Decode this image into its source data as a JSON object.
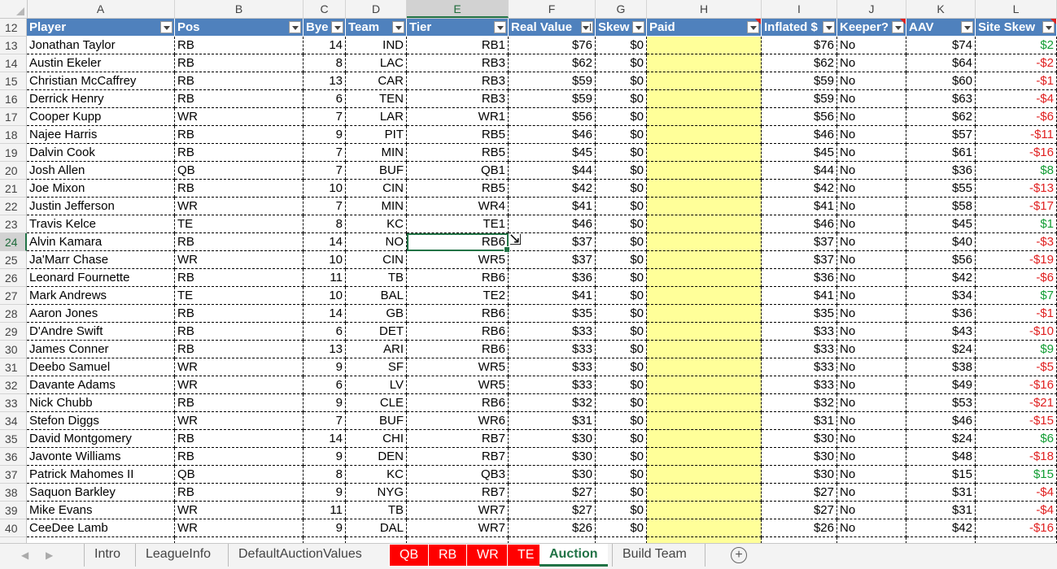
{
  "columns": [
    "A",
    "B",
    "C",
    "D",
    "E",
    "F",
    "G",
    "H",
    "I",
    "J",
    "K",
    "L"
  ],
  "selected_column": "E",
  "header_row_number": "12",
  "headers": [
    "Player",
    "Pos",
    "Bye",
    "Team",
    "Tier",
    "Real Value",
    "Skew",
    "Paid",
    "Inflated $",
    "Keeper?",
    "AAV",
    "Site Skew"
  ],
  "selected_row_number": "24",
  "rows": [
    {
      "n": "13",
      "player": "Jonathan Taylor",
      "pos": "RB",
      "bye": "14",
      "team": "IND",
      "tier": "RB1",
      "real": "$76",
      "skew": "$0",
      "paid": "",
      "inflated": "$76",
      "keeper": "No",
      "aav": "$74",
      "site": "$2",
      "sign": "pos"
    },
    {
      "n": "14",
      "player": "Austin Ekeler",
      "pos": "RB",
      "bye": "8",
      "team": "LAC",
      "tier": "RB3",
      "real": "$62",
      "skew": "$0",
      "paid": "",
      "inflated": "$62",
      "keeper": "No",
      "aav": "$64",
      "site": "-$2",
      "sign": "neg"
    },
    {
      "n": "15",
      "player": "Christian McCaffrey",
      "pos": "RB",
      "bye": "13",
      "team": "CAR",
      "tier": "RB3",
      "real": "$59",
      "skew": "$0",
      "paid": "",
      "inflated": "$59",
      "keeper": "No",
      "aav": "$60",
      "site": "-$1",
      "sign": "neg"
    },
    {
      "n": "16",
      "player": "Derrick Henry",
      "pos": "RB",
      "bye": "6",
      "team": "TEN",
      "tier": "RB3",
      "real": "$59",
      "skew": "$0",
      "paid": "",
      "inflated": "$59",
      "keeper": "No",
      "aav": "$63",
      "site": "-$4",
      "sign": "neg"
    },
    {
      "n": "17",
      "player": "Cooper Kupp",
      "pos": "WR",
      "bye": "7",
      "team": "LAR",
      "tier": "WR1",
      "real": "$56",
      "skew": "$0",
      "paid": "",
      "inflated": "$56",
      "keeper": "No",
      "aav": "$62",
      "site": "-$6",
      "sign": "neg"
    },
    {
      "n": "18",
      "player": "Najee Harris",
      "pos": "RB",
      "bye": "9",
      "team": "PIT",
      "tier": "RB5",
      "real": "$46",
      "skew": "$0",
      "paid": "",
      "inflated": "$46",
      "keeper": "No",
      "aav": "$57",
      "site": "-$11",
      "sign": "neg"
    },
    {
      "n": "19",
      "player": "Dalvin Cook",
      "pos": "RB",
      "bye": "7",
      "team": "MIN",
      "tier": "RB5",
      "real": "$45",
      "skew": "$0",
      "paid": "",
      "inflated": "$45",
      "keeper": "No",
      "aav": "$61",
      "site": "-$16",
      "sign": "neg"
    },
    {
      "n": "20",
      "player": "Josh Allen",
      "pos": "QB",
      "bye": "7",
      "team": "BUF",
      "tier": "QB1",
      "real": "$44",
      "skew": "$0",
      "paid": "",
      "inflated": "$44",
      "keeper": "No",
      "aav": "$36",
      "site": "$8",
      "sign": "pos"
    },
    {
      "n": "21",
      "player": "Joe Mixon",
      "pos": "RB",
      "bye": "10",
      "team": "CIN",
      "tier": "RB5",
      "real": "$42",
      "skew": "$0",
      "paid": "",
      "inflated": "$42",
      "keeper": "No",
      "aav": "$55",
      "site": "-$13",
      "sign": "neg"
    },
    {
      "n": "22",
      "player": "Justin Jefferson",
      "pos": "WR",
      "bye": "7",
      "team": "MIN",
      "tier": "WR4",
      "real": "$41",
      "skew": "$0",
      "paid": "",
      "inflated": "$41",
      "keeper": "No",
      "aav": "$58",
      "site": "-$17",
      "sign": "neg"
    },
    {
      "n": "23",
      "player": "Travis Kelce",
      "pos": "TE",
      "bye": "8",
      "team": "KC",
      "tier": "TE1",
      "real": "$46",
      "skew": "$0",
      "paid": "",
      "inflated": "$46",
      "keeper": "No",
      "aav": "$45",
      "site": "$1",
      "sign": "pos"
    },
    {
      "n": "24",
      "player": "Alvin Kamara",
      "pos": "RB",
      "bye": "14",
      "team": "NO",
      "tier": "RB6",
      "real": "$37",
      "skew": "$0",
      "paid": "",
      "inflated": "$37",
      "keeper": "No",
      "aav": "$40",
      "site": "-$3",
      "sign": "neg"
    },
    {
      "n": "25",
      "player": "Ja'Marr Chase",
      "pos": "WR",
      "bye": "10",
      "team": "CIN",
      "tier": "WR5",
      "real": "$37",
      "skew": "$0",
      "paid": "",
      "inflated": "$37",
      "keeper": "No",
      "aav": "$56",
      "site": "-$19",
      "sign": "neg"
    },
    {
      "n": "26",
      "player": "Leonard Fournette",
      "pos": "RB",
      "bye": "11",
      "team": "TB",
      "tier": "RB6",
      "real": "$36",
      "skew": "$0",
      "paid": "",
      "inflated": "$36",
      "keeper": "No",
      "aav": "$42",
      "site": "-$6",
      "sign": "neg"
    },
    {
      "n": "27",
      "player": "Mark Andrews",
      "pos": "TE",
      "bye": "10",
      "team": "BAL",
      "tier": "TE2",
      "real": "$41",
      "skew": "$0",
      "paid": "",
      "inflated": "$41",
      "keeper": "No",
      "aav": "$34",
      "site": "$7",
      "sign": "pos"
    },
    {
      "n": "28",
      "player": "Aaron Jones",
      "pos": "RB",
      "bye": "14",
      "team": "GB",
      "tier": "RB6",
      "real": "$35",
      "skew": "$0",
      "paid": "",
      "inflated": "$35",
      "keeper": "No",
      "aav": "$36",
      "site": "-$1",
      "sign": "neg"
    },
    {
      "n": "29",
      "player": "D'Andre Swift",
      "pos": "RB",
      "bye": "6",
      "team": "DET",
      "tier": "RB6",
      "real": "$33",
      "skew": "$0",
      "paid": "",
      "inflated": "$33",
      "keeper": "No",
      "aav": "$43",
      "site": "-$10",
      "sign": "neg"
    },
    {
      "n": "30",
      "player": "James Conner",
      "pos": "RB",
      "bye": "13",
      "team": "ARI",
      "tier": "RB6",
      "real": "$33",
      "skew": "$0",
      "paid": "",
      "inflated": "$33",
      "keeper": "No",
      "aav": "$24",
      "site": "$9",
      "sign": "pos"
    },
    {
      "n": "31",
      "player": "Deebo Samuel",
      "pos": "WR",
      "bye": "9",
      "team": "SF",
      "tier": "WR5",
      "real": "$33",
      "skew": "$0",
      "paid": "",
      "inflated": "$33",
      "keeper": "No",
      "aav": "$38",
      "site": "-$5",
      "sign": "neg"
    },
    {
      "n": "32",
      "player": "Davante Adams",
      "pos": "WR",
      "bye": "6",
      "team": "LV",
      "tier": "WR5",
      "real": "$33",
      "skew": "$0",
      "paid": "",
      "inflated": "$33",
      "keeper": "No",
      "aav": "$49",
      "site": "-$16",
      "sign": "neg"
    },
    {
      "n": "33",
      "player": "Nick Chubb",
      "pos": "RB",
      "bye": "9",
      "team": "CLE",
      "tier": "RB6",
      "real": "$32",
      "skew": "$0",
      "paid": "",
      "inflated": "$32",
      "keeper": "No",
      "aav": "$53",
      "site": "-$21",
      "sign": "neg"
    },
    {
      "n": "34",
      "player": "Stefon Diggs",
      "pos": "WR",
      "bye": "7",
      "team": "BUF",
      "tier": "WR6",
      "real": "$31",
      "skew": "$0",
      "paid": "",
      "inflated": "$31",
      "keeper": "No",
      "aav": "$46",
      "site": "-$15",
      "sign": "neg"
    },
    {
      "n": "35",
      "player": "David Montgomery",
      "pos": "RB",
      "bye": "14",
      "team": "CHI",
      "tier": "RB7",
      "real": "$30",
      "skew": "$0",
      "paid": "",
      "inflated": "$30",
      "keeper": "No",
      "aav": "$24",
      "site": "$6",
      "sign": "pos"
    },
    {
      "n": "36",
      "player": "Javonte Williams",
      "pos": "RB",
      "bye": "9",
      "team": "DEN",
      "tier": "RB7",
      "real": "$30",
      "skew": "$0",
      "paid": "",
      "inflated": "$30",
      "keeper": "No",
      "aav": "$48",
      "site": "-$18",
      "sign": "neg"
    },
    {
      "n": "37",
      "player": "Patrick Mahomes II",
      "pos": "QB",
      "bye": "8",
      "team": "KC",
      "tier": "QB3",
      "real": "$30",
      "skew": "$0",
      "paid": "",
      "inflated": "$30",
      "keeper": "No",
      "aav": "$15",
      "site": "$15",
      "sign": "pos"
    },
    {
      "n": "38",
      "player": "Saquon Barkley",
      "pos": "RB",
      "bye": "9",
      "team": "NYG",
      "tier": "RB7",
      "real": "$27",
      "skew": "$0",
      "paid": "",
      "inflated": "$27",
      "keeper": "No",
      "aav": "$31",
      "site": "-$4",
      "sign": "neg"
    },
    {
      "n": "39",
      "player": "Mike Evans",
      "pos": "WR",
      "bye": "11",
      "team": "TB",
      "tier": "WR7",
      "real": "$27",
      "skew": "$0",
      "paid": "",
      "inflated": "$27",
      "keeper": "No",
      "aav": "$31",
      "site": "-$4",
      "sign": "neg"
    },
    {
      "n": "40",
      "player": "CeeDee Lamb",
      "pos": "WR",
      "bye": "9",
      "team": "DAL",
      "tier": "WR7",
      "real": "$26",
      "skew": "$0",
      "paid": "",
      "inflated": "$26",
      "keeper": "No",
      "aav": "$42",
      "site": "-$16",
      "sign": "neg"
    }
  ],
  "sheet_tabs": [
    {
      "label": "Intro",
      "style": "normal"
    },
    {
      "label": "LeagueInfo",
      "style": "normal"
    },
    {
      "label": "DefaultAuctionValues",
      "style": "normal"
    },
    {
      "label": "QB",
      "style": "red"
    },
    {
      "label": "RB",
      "style": "red"
    },
    {
      "label": "WR",
      "style": "red"
    },
    {
      "label": "TE",
      "style": "red"
    },
    {
      "label": "Auction",
      "style": "active"
    },
    {
      "label": "Build Team",
      "style": "normal"
    }
  ],
  "add_sheet_symbol": "+",
  "nav_prev": "◀",
  "nav_next": "▶",
  "colors": {
    "header_fill": "#4f81bd",
    "paid_fill": "#ffff99",
    "negative": "#e02020",
    "positive": "#119d33",
    "accent": "#217346",
    "red_tab": "#ff0000"
  }
}
